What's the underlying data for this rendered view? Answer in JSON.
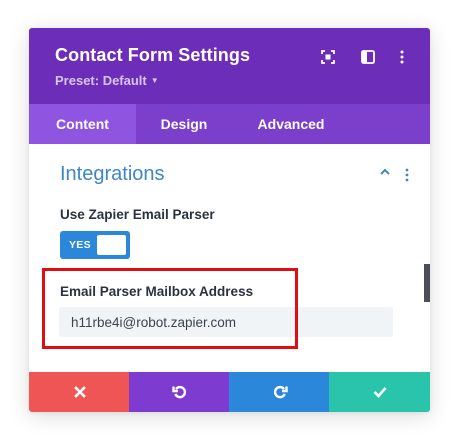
{
  "header": {
    "title": "Contact Form Settings",
    "preset": "Preset: Default",
    "icons": [
      "focus-icon",
      "sidebar-layout-icon",
      "more-vertical-icon"
    ]
  },
  "tabs": [
    {
      "label": "Content",
      "active": true
    },
    {
      "label": "Design",
      "active": false
    },
    {
      "label": "Advanced",
      "active": false
    }
  ],
  "section": {
    "title": "Integrations",
    "expanded": true
  },
  "zapier_toggle": {
    "label": "Use Zapier Email Parser",
    "state": "YES",
    "enabled": true
  },
  "mailbox": {
    "label": "Email Parser Mailbox Address",
    "value": "h11rbe4i@robot.zapier.com"
  },
  "footer": {
    "buttons": [
      "cancel",
      "undo",
      "redo",
      "save"
    ]
  },
  "colors": {
    "header_purple": "#6c2eb9",
    "tabs_purple": "#7b3fcc",
    "active_tab": "#8f55e0",
    "section_blue": "#3e86c6",
    "toggle_blue": "#2b87da",
    "cancel_red": "#ef5555",
    "undo_purple": "#7e3bd0",
    "redo_blue": "#2b87da",
    "save_green": "#29c4a9",
    "highlight_red": "#e00d12"
  }
}
